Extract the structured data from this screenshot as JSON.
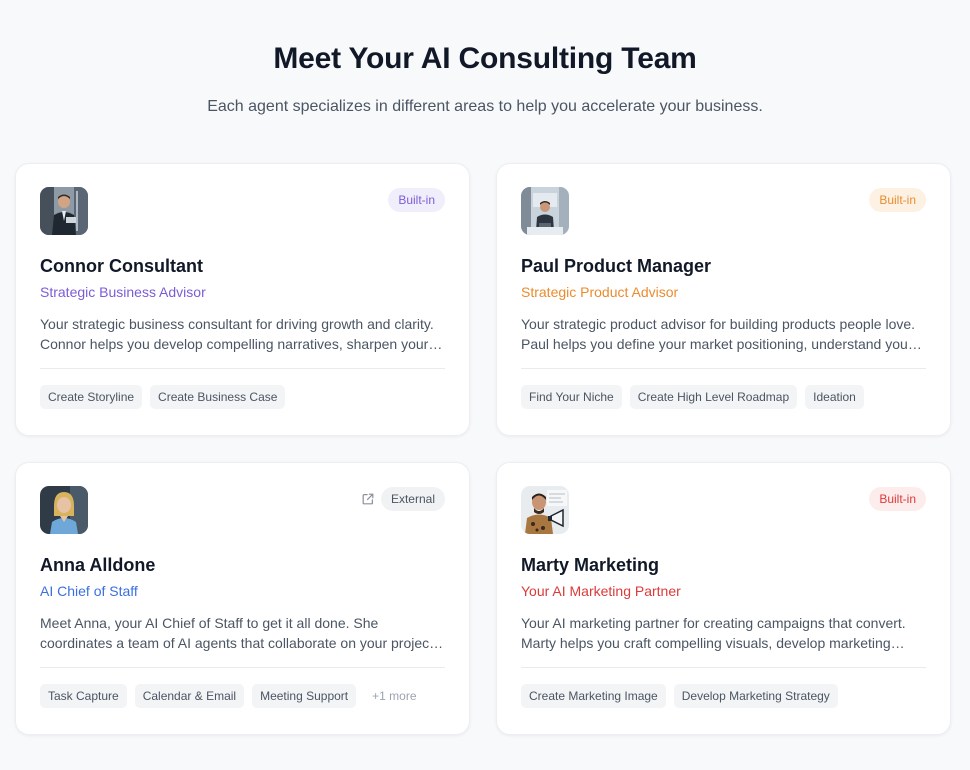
{
  "header": {
    "title": "Meet Your AI Consulting Team",
    "subtitle": "Each agent specializes in different areas to help you accelerate your business."
  },
  "agents": [
    {
      "name": "Connor Consultant",
      "role": "Strategic Business Advisor",
      "role_color": "#7c5cd6",
      "badge": "Built-in",
      "badge_bg": "#f1eefb",
      "badge_fg": "#7c5cd6",
      "desc_line1": "Your strategic business consultant for driving growth and clarity.",
      "desc_line2": "Connor helps you develop compelling narratives, sharpen your…",
      "tags": [
        "Create Storyline",
        "Create Business Case"
      ]
    },
    {
      "name": "Paul Product Manager",
      "role": "Strategic Product Advisor",
      "role_color": "#ea8c2e",
      "badge": "Built-in",
      "badge_bg": "#fdf1e4",
      "badge_fg": "#ea8c2e",
      "desc_line1": "Your strategic product advisor for building products people love.",
      "desc_line2": "Paul helps you define your market positioning, understand your…",
      "tags": [
        "Find Your Niche",
        "Create High Level Roadmap",
        "Ideation"
      ]
    },
    {
      "name": "Anna Alldone",
      "role": "AI Chief of Staff",
      "role_color": "#3b6fe0",
      "badge": "External",
      "badge_bg": "#f1f2f4",
      "badge_fg": "#4b5563",
      "external_icon": "external-link-icon",
      "desc_line1": "Meet Anna, your AI Chief of Staff to get it all done. She",
      "desc_line2": "coordinates a team of AI agents that collaborate on your projec…",
      "tags": [
        "Task Capture",
        "Calendar & Email",
        "Meeting Support"
      ],
      "more": "+1 more"
    },
    {
      "name": "Marty Marketing",
      "role": "Your AI Marketing Partner",
      "role_color": "#dc3a3a",
      "badge": "Built-in",
      "badge_bg": "#fdecec",
      "badge_fg": "#dc3a3a",
      "desc_line1": "Your AI marketing partner for creating campaigns that convert.",
      "desc_line2": "Marty helps you craft compelling visuals, develop marketing…",
      "tags": [
        "Create Marketing Image",
        "Develop Marketing Strategy"
      ]
    }
  ]
}
